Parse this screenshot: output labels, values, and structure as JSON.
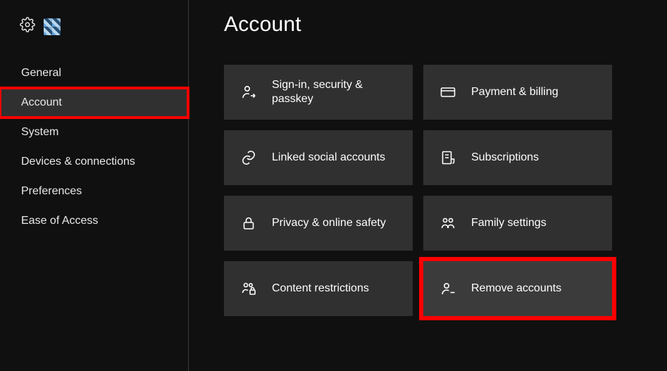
{
  "sidebar": {
    "items": [
      {
        "label": "General",
        "active": false
      },
      {
        "label": "Account",
        "active": true,
        "highlight": true
      },
      {
        "label": "System",
        "active": false
      },
      {
        "label": "Devices & connections",
        "active": false
      },
      {
        "label": "Preferences",
        "active": false
      },
      {
        "label": "Ease of Access",
        "active": false
      }
    ]
  },
  "page": {
    "title": "Account"
  },
  "tiles": [
    {
      "label": "Sign-in, security & passkey"
    },
    {
      "label": "Payment & billing"
    },
    {
      "label": "Linked social accounts"
    },
    {
      "label": "Subscriptions"
    },
    {
      "label": "Privacy & online safety"
    },
    {
      "label": "Family settings"
    },
    {
      "label": "Content restrictions"
    },
    {
      "label": "Remove accounts",
      "highlight": true
    }
  ],
  "colors": {
    "highlight": "#ff0000",
    "tile_bg": "#303030",
    "page_bg": "#101010"
  }
}
